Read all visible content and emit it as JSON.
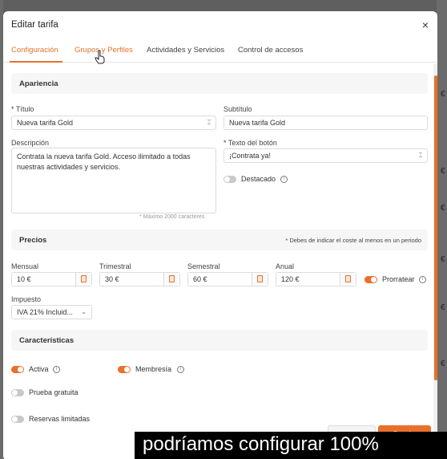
{
  "modal": {
    "title": "Editar tarifa",
    "close": "×"
  },
  "tabs": [
    {
      "label": "Configuración"
    },
    {
      "label": "Grupos y Perfiles"
    },
    {
      "label": "Actividades y Servicios"
    },
    {
      "label": "Control de accesos"
    }
  ],
  "apariencia": {
    "section_title": "Apariencia",
    "titulo_label": "* Título",
    "titulo_value": "Nueva tarifa Gold",
    "subtitulo_label": "Subtítulo",
    "subtitulo_value": "Nueva tarifa Gold",
    "descripcion_label": "Descripción",
    "descripcion_value": "Contrata la nueva tarifa Gold. Acceso ilimitado a todas nuestras actividades y servicios.",
    "descripcion_hint": "* Máximo 2000 caracteres",
    "boton_label": "* Texto del botón",
    "boton_value": "¡Contrata ya!",
    "destacado_label": "Destacado",
    "destacado_on": false
  },
  "precios": {
    "section_title": "Precios",
    "note": "* Debes de indicar el coste al menos en un periodo",
    "items": [
      {
        "label": "Mensual",
        "value": "10 €"
      },
      {
        "label": "Trimestral",
        "value": "30 €"
      },
      {
        "label": "Semestral",
        "value": "60 €"
      },
      {
        "label": "Anual",
        "value": "120 €"
      }
    ],
    "prorratear_label": "Prorratear",
    "prorratear_on": true,
    "impuesto_label": "Impuesto",
    "impuesto_value": "IVA 21% Incluid..."
  },
  "caracteristicas": {
    "section_title": "Características",
    "toggles": [
      {
        "label": "Activa",
        "on": true
      },
      {
        "label": "Membresía",
        "on": true
      },
      {
        "label": "Prueba gratuita",
        "on": false
      },
      {
        "label": "Reservas limitadas",
        "on": false
      }
    ]
  },
  "footer": {
    "cancel": "Cancelar",
    "save": "Guardar"
  },
  "caption": "podríamos configurar 100%",
  "colors": {
    "accent": "#e8702a"
  },
  "backdrop_fragments": [
    "€",
    "€",
    "€",
    "€",
    "€",
    "€"
  ]
}
